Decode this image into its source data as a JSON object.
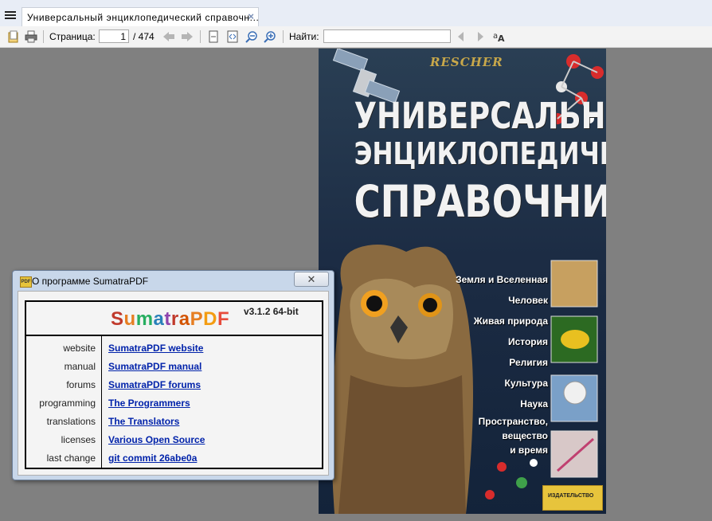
{
  "window": {
    "tab_title": "Универсальный  энциклопедический  справочн...",
    "tab_close": "×"
  },
  "toolbar": {
    "page_label": "Страница:",
    "page_value": "1",
    "page_total": "/ 474",
    "find_label": "Найти:",
    "find_value": "",
    "icons": [
      "open-file-icon",
      "print-icon",
      "back-arrow-icon",
      "forward-arrow-icon",
      "fit-page-icon",
      "fit-width-icon",
      "zoom-out-icon",
      "zoom-in-icon",
      "find-prev-icon",
      "find-next-icon",
      "match-case-icon"
    ]
  },
  "cover": {
    "publisher_logo": "RESCHER",
    "title_line1": "УНИВЕРСАЛЬНЫЙ",
    "title_line2": "ЭНЦИКЛОПЕДИЧЕСКИЙ",
    "title_line3": "СПРАВОЧНИК",
    "topics": [
      "Земля и Вселенная",
      "Человек",
      "Живая природа",
      "История",
      "Религия",
      "Культура",
      "Наука"
    ],
    "topic_last": [
      "Пространство,",
      "вещество",
      "и время"
    ],
    "badge": "ИЗДАТЕЛЬСТВО"
  },
  "about_dialog": {
    "title": "О программе SumatraPDF",
    "app_name_parts": [
      "S",
      "u",
      "m",
      "a",
      "t",
      "r",
      "a",
      "P",
      "D",
      "F"
    ],
    "app_name_colors": [
      "#c0392b",
      "#e67e22",
      "#27ae60",
      "#2980b9",
      "#8e44ad",
      "#c0392b",
      "#d35400",
      "#e67e22",
      "#f39c12",
      "#e74c3c"
    ],
    "version": "v3.1.2 64-bit",
    "rows": [
      {
        "key": "website",
        "value": "SumatraPDF website"
      },
      {
        "key": "manual",
        "value": "SumatraPDF manual"
      },
      {
        "key": "forums",
        "value": "SumatraPDF forums"
      },
      {
        "key": "programming",
        "value": "The Programmers"
      },
      {
        "key": "translations",
        "value": "The Translators"
      },
      {
        "key": "licenses",
        "value": "Various Open Source"
      },
      {
        "key": "last change",
        "value": "git commit 26abe0a"
      }
    ]
  }
}
